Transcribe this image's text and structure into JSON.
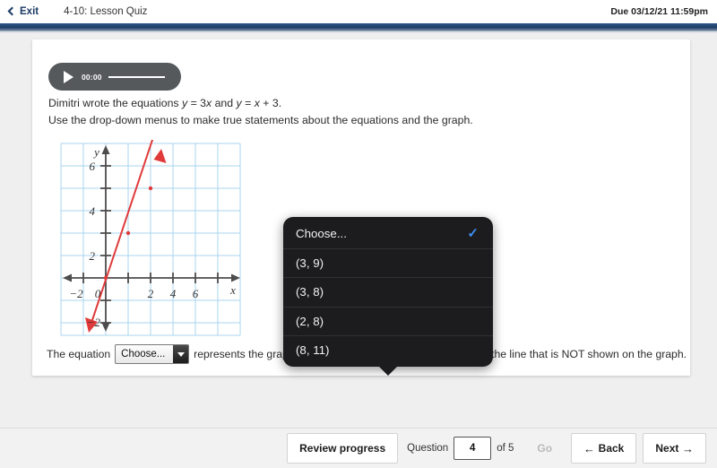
{
  "header": {
    "exit_label": "Exit",
    "quiz_title": "4-10: Lesson Quiz",
    "due_label": "Due 03/12/21 11:59pm",
    "accent_blue": "#1f3f66"
  },
  "audio": {
    "time": "00:00",
    "play_icon": "play-icon"
  },
  "prompt": {
    "line1_a": "Dimitri wrote the equations ",
    "line1_y1": "y",
    "line1_b": " = 3",
    "line1_x1": "x",
    "line1_c": " and ",
    "line1_y2": "y",
    "line1_d": " = ",
    "line1_x2": "x",
    "line1_e": " + 3.",
    "line2": "Use the drop-down menus to make true statements about the equations and the graph."
  },
  "graph": {
    "x_label": "x",
    "y_label": "y",
    "x_ticks": [
      "-2",
      "0",
      "2",
      "4",
      "6"
    ],
    "y_ticks": [
      "2",
      "4",
      "6"
    ],
    "y_neg_tick": "2",
    "line_color": "#e03a3a",
    "grid_color": "#a8d4ef",
    "axis_color": "#4d4d4d",
    "points": [
      [
        0,
        0
      ],
      [
        1,
        3
      ],
      [
        2,
        6
      ]
    ],
    "equation": "y = 3x"
  },
  "sentence": {
    "part1": "The equation",
    "dropdown1_value": "Choose...",
    "part2": "represents the graph. The point",
    "dropdown2_value": "Choose...",
    "part3": "is a point on the line that is NOT shown on the graph."
  },
  "dropdown": {
    "selected": "Choose...",
    "check_icon": "check-icon",
    "check_color": "#3c8cf0",
    "items": [
      {
        "label": "Choose...",
        "selected": true
      },
      {
        "label": "(3, 9)",
        "selected": false
      },
      {
        "label": "(3, 8)",
        "selected": false
      },
      {
        "label": "(2, 8)",
        "selected": false
      },
      {
        "label": "(8, 11)",
        "selected": false
      }
    ]
  },
  "bottom_nav": {
    "review_label": "Review progress",
    "question_label": "Question",
    "question_value": "4",
    "of_label": "of 5",
    "go_label": "Go",
    "back_label": "Back",
    "back_icon": "arrow-left-icon",
    "next_label": "Next",
    "next_icon": "arrow-right-icon"
  }
}
